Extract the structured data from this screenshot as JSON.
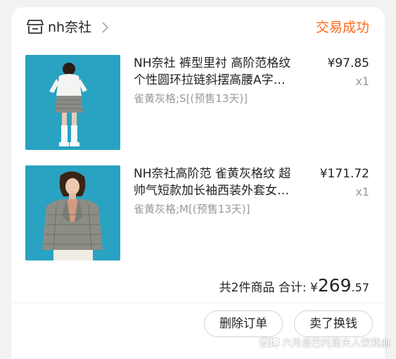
{
  "shop": {
    "name": "nh奈社",
    "status": "交易成功",
    "icon": "store-icon",
    "chevron": "chevron-right-icon"
  },
  "items": [
    {
      "title": "NH奈社 裤型里衬 高阶范格纹个性圆环拉链斜摆高腰A字…",
      "sku": "雀黄灰格;S[(预售13天)]",
      "price": "¥97.85",
      "qty": "x1",
      "image": "model-wearing-skirt-photo"
    },
    {
      "title": "NH奈社高阶范 雀黄灰格纹 超帅气短款加长袖西装外套女…",
      "sku": "雀黄灰格;M[(预售13天)]",
      "price": "¥171.72",
      "qty": "x1",
      "image": "model-wearing-blazer-photo"
    }
  ],
  "summary": {
    "count_text": "共2件商品",
    "total_label": "合计:",
    "currency": "¥",
    "total_int": "269",
    "total_dec": ".57"
  },
  "actions": {
    "delete_label": "删除订单",
    "resell_label": "卖了换钱"
  },
  "watermark": {
    "brand": "微博",
    "text": "六月是巴托里夫人饮我血"
  },
  "colors": {
    "accent": "#ff6a1a",
    "thumb_bg": "#29a0c0",
    "muted": "#999999"
  }
}
